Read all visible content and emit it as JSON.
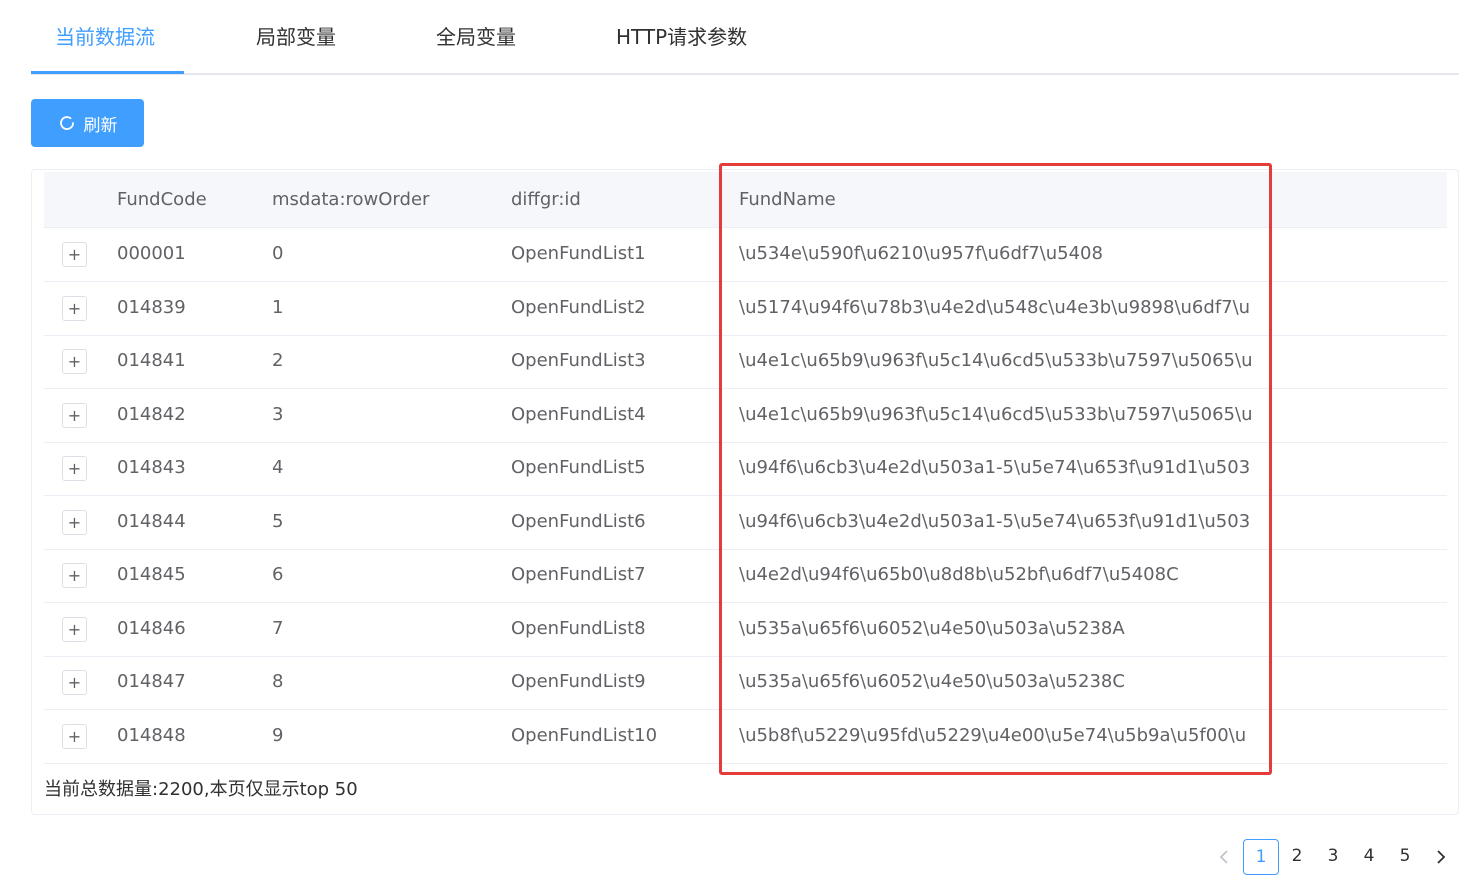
{
  "tabs": [
    {
      "label": "当前数据流"
    },
    {
      "label": "局部变量"
    },
    {
      "label": "全局变量"
    },
    {
      "label": "HTTP请求参数"
    }
  ],
  "toolbar": {
    "refresh_label": "刷新",
    "refresh_icon": "refresh-icon"
  },
  "table": {
    "columns": [
      "FundCode",
      "msdata:rowOrder",
      "diffgr:id",
      "FundName"
    ],
    "expand_symbol": "+",
    "rows": [
      {
        "code": "000001",
        "order": "0",
        "id": "OpenFundList1",
        "name": "\\u534e\\u590f\\u6210\\u957f\\u6df7\\u5408"
      },
      {
        "code": "014839",
        "order": "1",
        "id": "OpenFundList2",
        "name": "\\u5174\\u94f6\\u78b3\\u4e2d\\u548c\\u4e3b\\u9898\\u6df7\\u"
      },
      {
        "code": "014841",
        "order": "2",
        "id": "OpenFundList3",
        "name": "\\u4e1c\\u65b9\\u963f\\u5c14\\u6cd5\\u533b\\u7597\\u5065\\u"
      },
      {
        "code": "014842",
        "order": "3",
        "id": "OpenFundList4",
        "name": "\\u4e1c\\u65b9\\u963f\\u5c14\\u6cd5\\u533b\\u7597\\u5065\\u"
      },
      {
        "code": "014843",
        "order": "4",
        "id": "OpenFundList5",
        "name": "\\u94f6\\u6cb3\\u4e2d\\u503a1-5\\u5e74\\u653f\\u91d1\\u503"
      },
      {
        "code": "014844",
        "order": "5",
        "id": "OpenFundList6",
        "name": "\\u94f6\\u6cb3\\u4e2d\\u503a1-5\\u5e74\\u653f\\u91d1\\u503"
      },
      {
        "code": "014845",
        "order": "6",
        "id": "OpenFundList7",
        "name": "\\u4e2d\\u94f6\\u65b0\\u8d8b\\u52bf\\u6df7\\u5408C"
      },
      {
        "code": "014846",
        "order": "7",
        "id": "OpenFundList8",
        "name": "\\u535a\\u65f6\\u6052\\u4e50\\u503a\\u5238A"
      },
      {
        "code": "014847",
        "order": "8",
        "id": "OpenFundList9",
        "name": "\\u535a\\u65f6\\u6052\\u4e50\\u503a\\u5238C"
      },
      {
        "code": "014848",
        "order": "9",
        "id": "OpenFundList10",
        "name": "\\u5b8f\\u5229\\u95fd\\u5229\\u4e00\\u5e74\\u5b9a\\u5f00\\u"
      }
    ],
    "footer": "当前总数据量:2200,本页仅显示top 50"
  },
  "pagination": {
    "pages": [
      "1",
      "2",
      "3",
      "4",
      "5"
    ],
    "current": "1",
    "prev_icon": "chevron-left-icon",
    "next_icon": "chevron-right-icon"
  },
  "colors": {
    "accent": "#409eff",
    "highlight": "#e63b3b"
  }
}
